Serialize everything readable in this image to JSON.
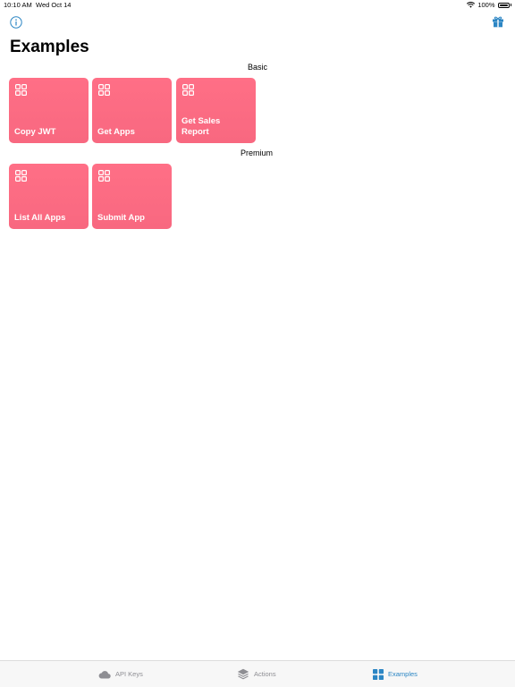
{
  "status_bar": {
    "time": "10:10 AM",
    "date": "Wed Oct 14",
    "battery": "100%"
  },
  "header": {
    "title": "Examples"
  },
  "sections": {
    "basic": {
      "title": "Basic",
      "items": [
        {
          "label": "Copy JWT"
        },
        {
          "label": "Get Apps"
        },
        {
          "label": "Get Sales Report"
        }
      ]
    },
    "premium": {
      "title": "Premium",
      "items": [
        {
          "label": "List All Apps"
        },
        {
          "label": "Submit App"
        }
      ]
    }
  },
  "tabs": [
    {
      "label": "API Keys",
      "icon": "cloud-icon"
    },
    {
      "label": "Actions",
      "icon": "layers-icon"
    },
    {
      "label": "Examples",
      "icon": "grid-icon",
      "active": true
    }
  ],
  "colors": {
    "tile": "#f86880",
    "accent": "#2c86c4",
    "inactive_tab": "#8e8e93"
  }
}
